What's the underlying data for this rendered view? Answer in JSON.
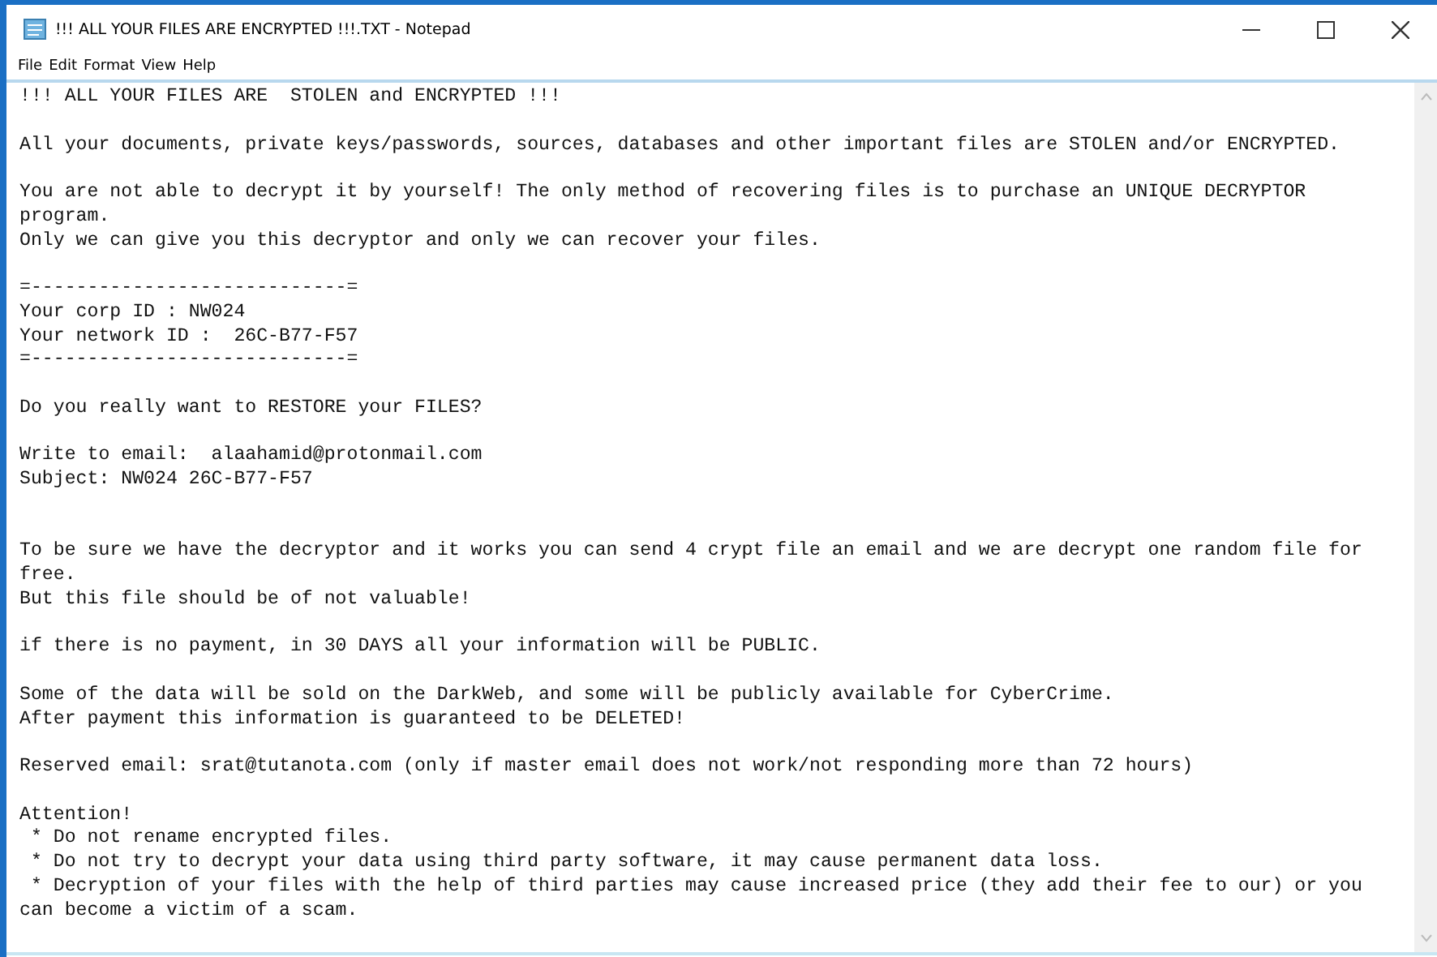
{
  "window": {
    "title": "!!! ALL YOUR FILES ARE ENCRYPTED !!!.TXT - Notepad"
  },
  "menu": [
    "File",
    "Edit",
    "Format",
    "View",
    "Help"
  ],
  "paragraphs": [
    {
      "extra_gap": false,
      "lines": [
        "!!! ALL YOUR FILES ARE  STOLEN and ENCRYPTED !!!"
      ]
    },
    {
      "extra_gap": false,
      "lines": [
        "All your documents, private keys/passwords, sources, databases and other important files are STOLEN and/or ENCRYPTED."
      ]
    },
    {
      "extra_gap": false,
      "lines": [
        "You are not able to decrypt it by yourself! The only method of recovering files is to purchase an UNIQUE DECRYPTOR",
        "program.",
        "Only we can give you this decryptor and only we can recover your files."
      ]
    },
    {
      "extra_gap": false,
      "lines": [
        "=----------------------------=",
        "Your corp ID : NW024",
        "Your network ID :  26C-B77-F57",
        "=----------------------------="
      ]
    },
    {
      "extra_gap": false,
      "lines": [
        "Do you really want to RESTORE your FILES?"
      ]
    },
    {
      "extra_gap": false,
      "lines": [
        "Write to email:  alaahamid@protonmail.com",
        "Subject: NW024 26C-B77-F57"
      ]
    },
    {
      "extra_gap": true,
      "lines": [
        "To be sure we have the decryptor and it works you can send 4 crypt file an email and we are decrypt one random file for",
        "free.",
        "But this file should be of not valuable!"
      ]
    },
    {
      "extra_gap": false,
      "lines": [
        "if there is no payment, in 30 DAYS all your information will be PUBLIC."
      ]
    },
    {
      "extra_gap": false,
      "lines": [
        "Some of the data will be sold on the DarkWeb, and some will be publicly available for CyberCrime.",
        "After payment this information is guaranteed to be DELETED!"
      ]
    },
    {
      "extra_gap": false,
      "lines": [
        "Reserved email: srat@tutanota.com (only if master email does not work/not responding more than 72 hours)"
      ]
    },
    {
      "extra_gap": false,
      "lines": [
        "Attention!",
        " * Do not rename encrypted files.",
        " * Do not try to decrypt your data using third party software, it may cause permanent data loss.",
        " * Decryption of your files with the help of third parties may cause increased price (they add their fee to our) or you",
        "can become a victim of a scam."
      ]
    }
  ]
}
